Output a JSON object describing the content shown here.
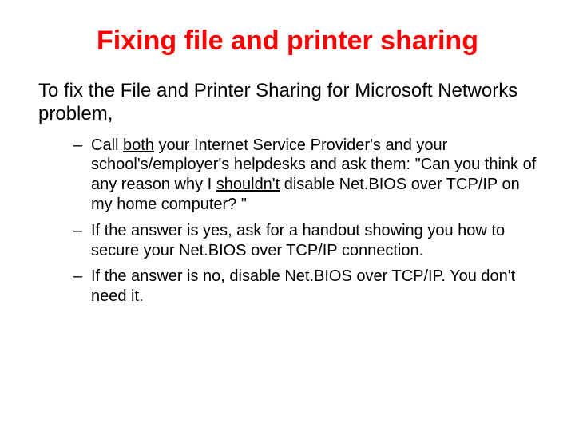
{
  "title": "Fixing file and printer sharing",
  "intro": "To fix the File and Printer Sharing for Microsoft Networks problem,",
  "bullets": [
    {
      "pre": "Call ",
      "u1": "both",
      "mid": " your Internet Service Provider's and your school's/employer's helpdesks and ask them: \"Can you think of any reason why I ",
      "u2": "shouldn't",
      "post": " disable Net.BIOS over TCP/IP on my home computer? \""
    },
    {
      "text": "If the answer is yes, ask for a handout showing you how to secure your Net.BIOS over TCP/IP connection."
    },
    {
      "text": "If the answer is no, disable Net.BIOS over TCP/IP. You don't need it."
    }
  ]
}
